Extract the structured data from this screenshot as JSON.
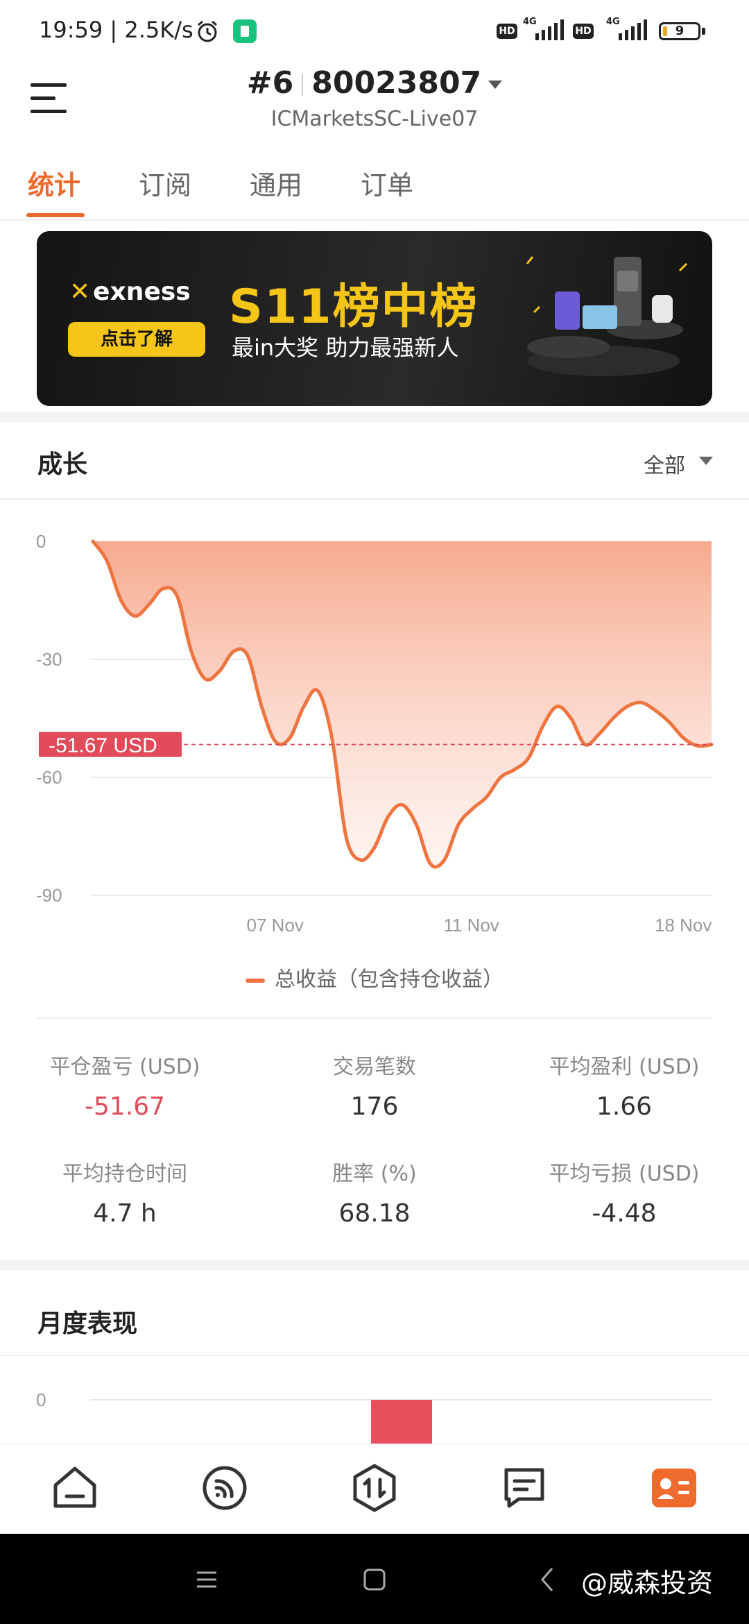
{
  "status_bar": {
    "time": "19:59",
    "net_speed": "2.5K/s",
    "hd_label": "HD",
    "network_type": "4G",
    "battery": "9",
    "icons": [
      "alarm-icon",
      "app-badge-icon",
      "signal-icon",
      "battery-icon"
    ]
  },
  "header": {
    "account_prefix": "#6",
    "account_number": "80023807",
    "server": "ICMarketsSC-Live07"
  },
  "tabs": [
    {
      "label": "统计",
      "active": true
    },
    {
      "label": "订阅",
      "active": false
    },
    {
      "label": "通用",
      "active": false
    },
    {
      "label": "订单",
      "active": false
    }
  ],
  "banner": {
    "brand": "exness",
    "cta": "点击了解",
    "headline": "S11榜中榜",
    "subline": "最in大奖 助力最强新人"
  },
  "growth": {
    "title": "成长",
    "filter": "全部",
    "current_label": "-51.67 USD",
    "legend": "总收益（包含持仓收益）"
  },
  "chart_data": [
    {
      "type": "area",
      "title": "成长",
      "y_ticks": [
        0,
        -30,
        -60,
        -90
      ],
      "y_tick_labels": [
        "0",
        "-30",
        "-60",
        "-90"
      ],
      "ylim": [
        -90,
        0
      ],
      "x_ticks": [
        "07 Nov",
        "11 Nov",
        "18 Nov"
      ],
      "x_tick_index": [
        13,
        27,
        44
      ],
      "current_value": -51.67,
      "current_label": "-51.67 USD",
      "series": [
        {
          "name": "总收益（包含持仓收益）",
          "x": [
            0,
            1,
            2,
            3,
            4,
            5,
            6,
            7,
            8,
            9,
            10,
            11,
            12,
            13,
            14,
            15,
            16,
            17,
            18,
            19,
            20,
            21,
            22,
            23,
            24,
            25,
            26,
            27,
            28,
            29,
            30,
            31,
            32,
            33,
            34,
            35,
            36,
            37,
            38,
            39,
            40,
            41,
            42,
            43,
            44
          ],
          "values": [
            0,
            -5,
            -15,
            -19,
            -16,
            -12,
            -14,
            -28,
            -35,
            -33,
            -28,
            -29,
            -42,
            -51,
            -50,
            -42,
            -38,
            -50,
            -75,
            -81,
            -78,
            -70,
            -67,
            -72,
            -82,
            -81,
            -72,
            -68,
            -65,
            -60,
            -58,
            -55,
            -47,
            -42,
            -45,
            -51.67,
            -49,
            -45,
            -42,
            -41,
            -43,
            -46,
            -50,
            -52,
            -51.67
          ],
          "color": "#ee7440"
        }
      ],
      "grid": true,
      "reference_line_color": "#d8455a"
    },
    {
      "type": "bar",
      "title": "月度表现",
      "y_tick_labels": [
        "0"
      ],
      "values": [
        -51.67
      ],
      "color": "#e94e5c"
    }
  ],
  "stats": [
    {
      "label": "平仓盈亏 (USD)",
      "value": "-51.67",
      "negative": true
    },
    {
      "label": "交易笔数",
      "value": "176",
      "negative": false
    },
    {
      "label": "平均盈利 (USD)",
      "value": "1.66",
      "negative": false
    },
    {
      "label": "平均持仓时间",
      "value": "4.7 h",
      "negative": false
    },
    {
      "label": "胜率 (%)",
      "value": "68.18",
      "negative": false
    },
    {
      "label": "平均亏损 (USD)",
      "value": "-4.48",
      "negative": false
    }
  ],
  "monthly": {
    "title": "月度表现"
  },
  "bottom_nav": [
    {
      "icon": "home-icon",
      "active": false
    },
    {
      "icon": "signal-feed-icon",
      "active": false
    },
    {
      "icon": "trade-icon",
      "active": false
    },
    {
      "icon": "chat-icon",
      "active": false
    },
    {
      "icon": "profile-card-icon",
      "active": true
    }
  ],
  "system_nav": {
    "watermark": "@威森投资"
  },
  "colors": {
    "accent": "#ee6b2d",
    "negative": "#e14b5a",
    "banner_gold": "#f5c518"
  }
}
